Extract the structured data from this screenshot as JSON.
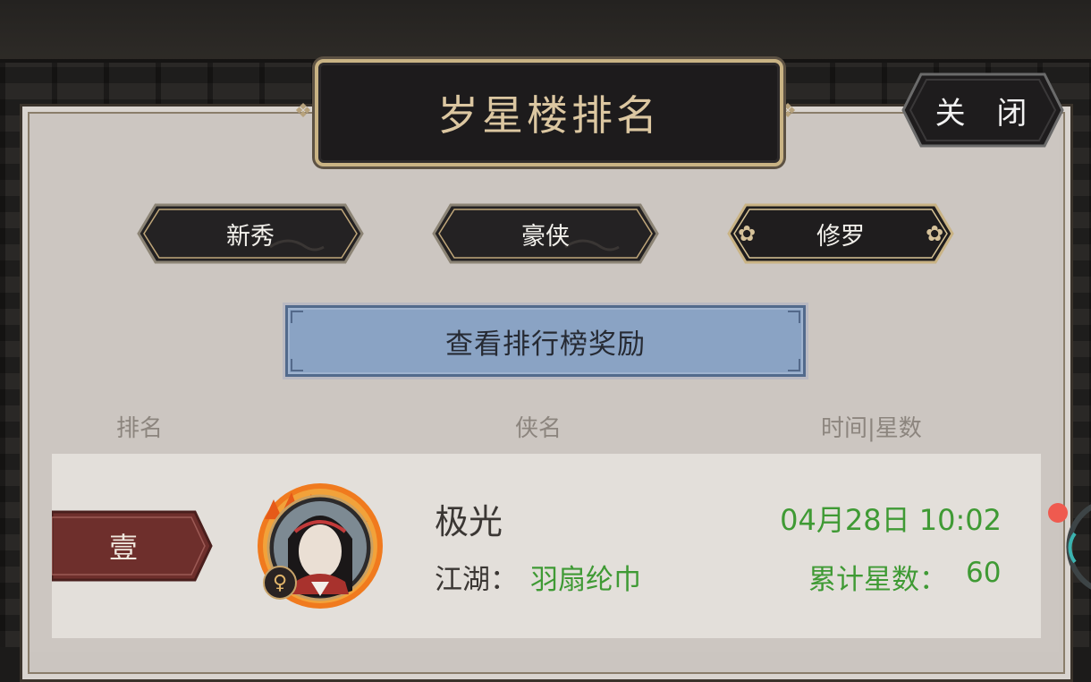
{
  "title": "岁星楼排名",
  "close_label": "关 闭",
  "tabs": [
    {
      "label": "新秀"
    },
    {
      "label": "豪侠"
    },
    {
      "label": "修罗"
    }
  ],
  "reward_button": "查看排行榜奖励",
  "columns": {
    "rank": "排名",
    "name": "侠名",
    "time_stars": "时间|星数"
  },
  "rows": [
    {
      "rank": "壹",
      "name": "极光",
      "sect_label": "江湖：",
      "sect_value": "羽扇纶巾",
      "time": "04月28日 10:02",
      "stars_label": "累计星数：",
      "stars_value": "60",
      "gender_symbol": "♀"
    }
  ],
  "colors": {
    "panel": "#cbc5c0",
    "plaque": "#1d1b1c",
    "gold": "#c9b384",
    "reward_button": "#8aa3c4",
    "green_text": "#3f9a34",
    "rank_badge": "#6e2f2c"
  }
}
